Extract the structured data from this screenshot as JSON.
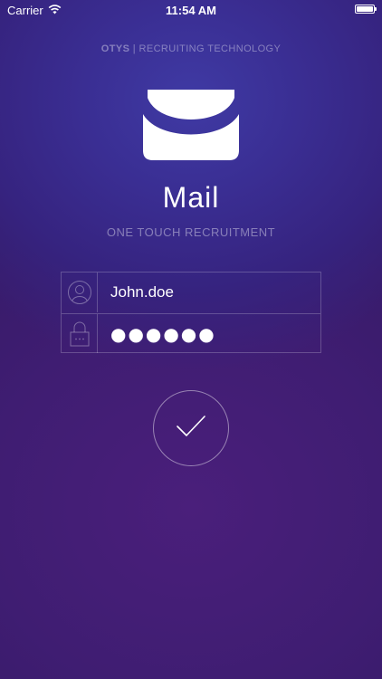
{
  "status_bar": {
    "carrier": "Carrier",
    "time": "11:54 AM",
    "wifi_icon": "wifi-icon",
    "battery_icon": "battery-icon",
    "battery_level": 1.0
  },
  "header": {
    "brand_strong": "OTYS",
    "brand_separator": " | ",
    "brand_rest": "RECRUITING TECHNOLOGY",
    "logo_icon": "mail-envelope-icon"
  },
  "app": {
    "title": "Mail",
    "subtitle": "ONE TOUCH RECRUITMENT"
  },
  "login": {
    "username_icon": "user-icon",
    "username_value": "John.doe",
    "password_icon": "lock-icon",
    "password_value": "●●●●●●"
  },
  "submit": {
    "icon": "checkmark-icon"
  },
  "colors": {
    "background_top": "#3f3aa4",
    "background_bottom": "#351a66",
    "text": "#ffffff"
  }
}
